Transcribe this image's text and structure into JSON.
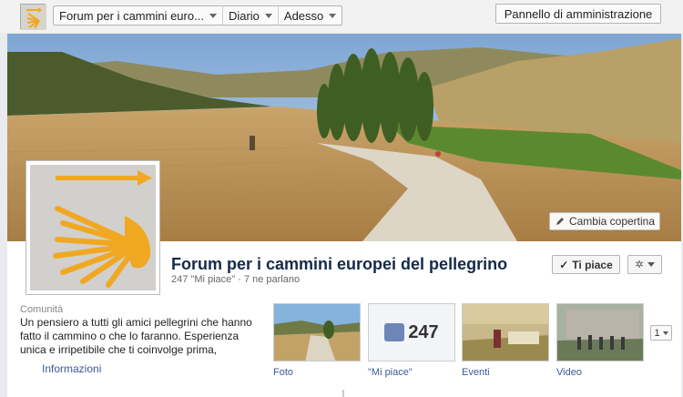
{
  "topbar": {
    "crumbs": [
      "Forum per i cammini euro...",
      "Diario",
      "Adesso"
    ],
    "admin_label": "Pannello di amministrazione"
  },
  "cover": {
    "change_label": "Cambia copertina"
  },
  "page": {
    "name": "Forum per i cammini europei del pellegrino",
    "stats": "247 \"Mi piace\" · 7 ne parlano",
    "like_label": "Ti piace"
  },
  "about": {
    "category": "Comunità",
    "description": "Un pensiero a tutti gli amici pellegrini che hanno fatto il cammino o che lo faranno. Esperienza unica e irripetibile che ti coinvolge prima,",
    "info_label": "Informazioni"
  },
  "apps": {
    "foto_label": "Foto",
    "likes_count": "247",
    "likes_label": "\"Mi piace\"",
    "eventi_label": "Eventi",
    "video_label": "Video",
    "pager_value": "1"
  },
  "colors": {
    "accent": "#3b5998",
    "title": "#142a48",
    "arrow_yellow": "#f0a822"
  }
}
